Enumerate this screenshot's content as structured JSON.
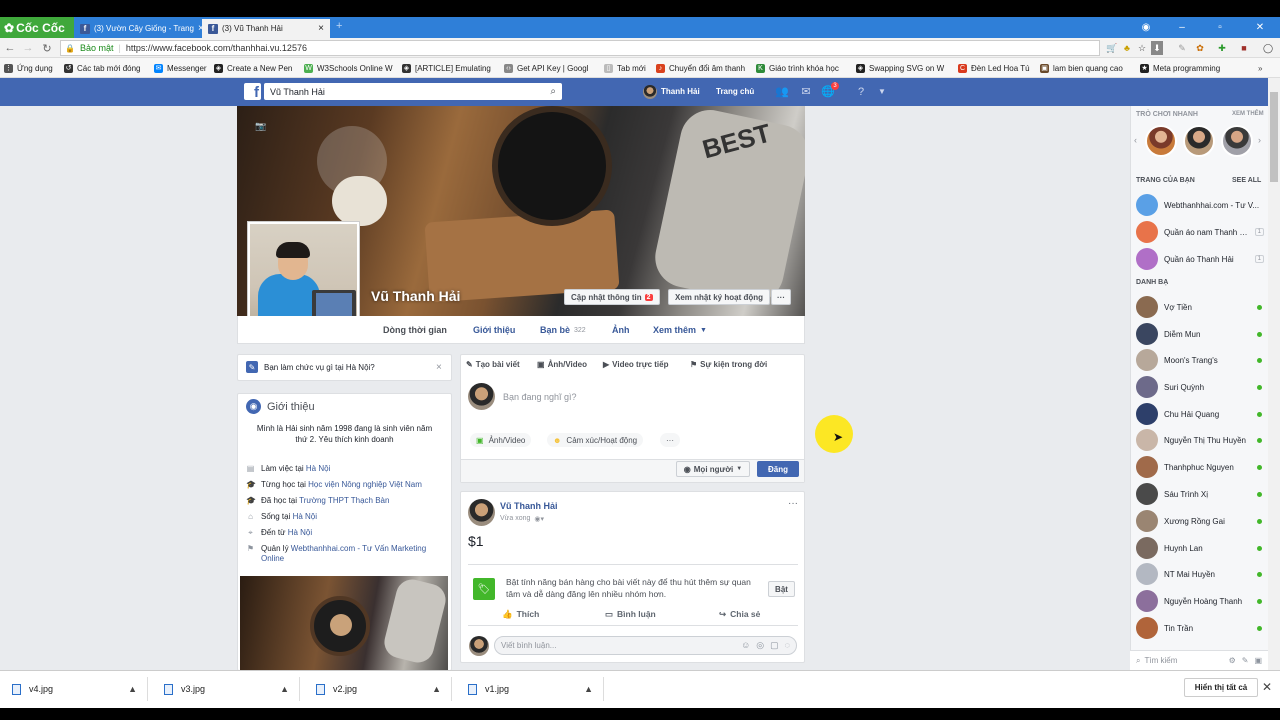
{
  "browser": {
    "brand": "Cốc Cốc",
    "tabs": [
      {
        "title": "(3) Vườn Cây Giống - Trang",
        "active": false
      },
      {
        "title": "(3) Vũ Thanh Hải",
        "active": true
      }
    ],
    "security_label": "Bảo mật",
    "url": "https://www.facebook.com/thanhhai.vu.12576",
    "bookmarks": [
      "Ứng dụng",
      "Các tab mới đóng",
      "Messenger",
      "Create a New Pen",
      "W3Schools Online W",
      "[ARTICLE] Emulating",
      "Get API Key | Googl",
      "Tab mới",
      "Chuyển đổi âm thanh",
      "Giáo trình khóa học",
      "Swapping SVG on W",
      "Đèn Led Hoa Tú",
      "lam bien quang cao",
      "Meta programming"
    ]
  },
  "fb_header": {
    "search_value": "Vũ Thanh Hải",
    "user_name": "Thanh Hải",
    "home_label": "Trang chủ",
    "notif_count": "3"
  },
  "profile": {
    "name": "Vũ Thanh Hải",
    "update_info_label": "Cập nhật thông tin",
    "update_info_badge": "2",
    "activity_log_label": "Xem nhật ký hoạt động",
    "more_label": "···",
    "nav": {
      "timeline": "Dòng thời gian",
      "about": "Giới thiệu",
      "friends": "Bạn bè",
      "friends_count": "322",
      "photos": "Ảnh",
      "more": "Xem thêm"
    }
  },
  "left": {
    "prompt": "Bạn làm chức vụ gì tại Hà Nội?",
    "intro_title": "Giới thiệu",
    "bio": "Mình là Hải sinh năm 1998 đang là sinh viên năm thứ 2. Yêu thích kinh doanh",
    "rows": [
      {
        "pre": "Làm việc tại ",
        "link": "Hà Nội"
      },
      {
        "pre": "Từng học tại ",
        "link": "Học viện Nông nghiệp Việt Nam"
      },
      {
        "pre": "Đã học tại ",
        "link": "Trường THPT Thạch Bàn"
      },
      {
        "pre": "Sống tại ",
        "link": "Hà Nội"
      },
      {
        "pre": "Đến từ ",
        "link": "Hà Nội"
      },
      {
        "pre": "Quản lý ",
        "link": "Webthanhhai.com - Tư Vấn Marketing Online"
      }
    ]
  },
  "composer": {
    "tabs": [
      "Tạo bài viết",
      "Ảnh/Video",
      "Video trực tiếp",
      "Sự kiện trong đời"
    ],
    "placeholder": "Bạn đang nghĩ gì?",
    "actions": [
      "Ảnh/Video",
      "Cảm xúc/Hoạt động",
      "···"
    ],
    "audience": "Mọi người",
    "post_label": "Đăng"
  },
  "post": {
    "author": "Vũ Thanh Hải",
    "time": "Vừa xong",
    "body": "$1",
    "sell_text": "Bật tính năng bán hàng cho bài viết này để thu hút thêm sự quan tâm và dễ dàng đăng lên nhiều nhóm hơn.",
    "sell_button": "Bật",
    "like": "Thích",
    "comment": "Bình luận",
    "share": "Chia sẻ",
    "comment_placeholder": "Viết bình luận..."
  },
  "sidebar": {
    "games_title": "TRÒ CHƠI NHANH",
    "games_more": "XEM THÊM",
    "pages_title": "TRANG CỦA BẠN",
    "pages_see_all": "SEE ALL",
    "pages": [
      {
        "name": "Webthanhhai.com - Tư V...",
        "count": "",
        "color": "#5aa0e6"
      },
      {
        "name": "Quần áo nam Thanh Hải",
        "count": "1",
        "color": "#e8734a"
      },
      {
        "name": "Quần áo Thanh Hải",
        "count": "1",
        "color": "#b06fc7"
      }
    ],
    "contacts_title": "DANH BẠ",
    "contacts": [
      {
        "name": "Vợ Tiền",
        "color": "#8a6a50"
      },
      {
        "name": "Diễm Mun",
        "color": "#3a4660"
      },
      {
        "name": "Moon's Trang's",
        "color": "#b7a89a"
      },
      {
        "name": "Suri Quỳnh",
        "color": "#6d6a8a"
      },
      {
        "name": "Chu Hải Quang",
        "color": "#2d3f6a"
      },
      {
        "name": "Nguyễn Thị Thu Huyền",
        "color": "#c9b6a8"
      },
      {
        "name": "Thanhphuc Nguyen",
        "color": "#a06a4a"
      },
      {
        "name": "Sáu Trình Xị",
        "color": "#4a4a4a"
      },
      {
        "name": "Xương Rồng Gai",
        "color": "#9a8572"
      },
      {
        "name": "Huynh Lan",
        "color": "#7a6a60"
      },
      {
        "name": "NT Mai Huyền",
        "color": "#b3b8c2"
      },
      {
        "name": "Nguyễn Hoàng Thanh",
        "color": "#8c6f9c"
      },
      {
        "name": "Tin Trần",
        "color": "#b0643a"
      }
    ],
    "search_placeholder": "Tìm kiếm"
  },
  "downloads": {
    "files": [
      "v4.jpg",
      "v3.jpg",
      "v2.jpg",
      "v1.jpg"
    ],
    "show_all": "Hiển thị tất cả"
  }
}
